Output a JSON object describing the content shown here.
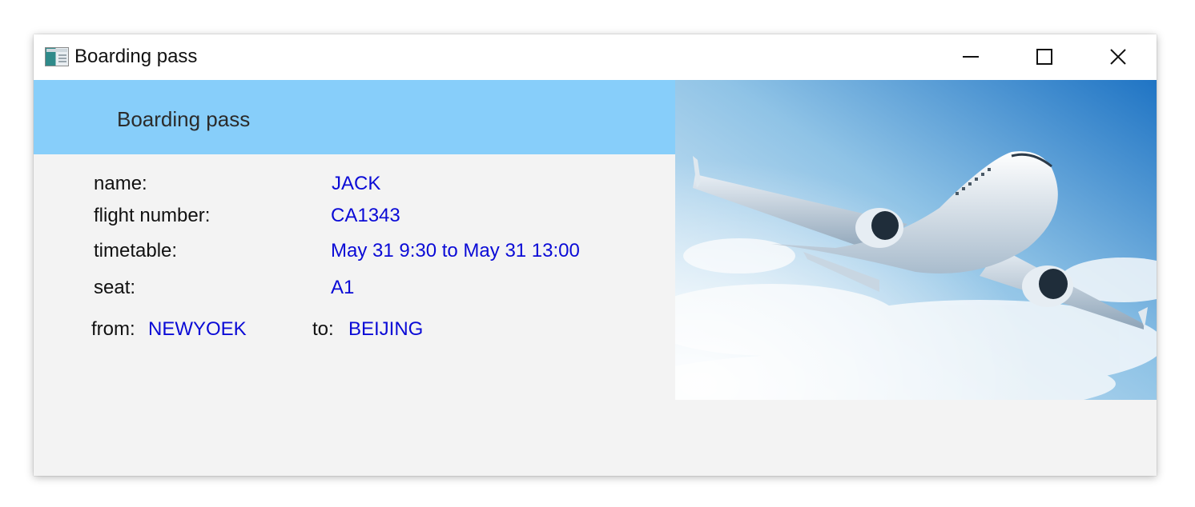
{
  "window": {
    "title": "Boarding pass",
    "icon": "application-icon",
    "controls": [
      "minimize-icon",
      "maximize-icon",
      "close-icon"
    ]
  },
  "banner": {
    "title": "Boarding pass",
    "color": "#87cefa"
  },
  "fields": {
    "name": {
      "label": "name:",
      "value": "JACK"
    },
    "flight_number": {
      "label": "flight number:",
      "value": "CA1343"
    },
    "timetable": {
      "label": "timetable:",
      "value": "May 31 9:30 to May 31 13:00"
    },
    "seat": {
      "label": "seat:",
      "value": "A1"
    },
    "from": {
      "label": "from:",
      "value": "NEWYOEK"
    },
    "to": {
      "label": "to:",
      "value": "BEIJING"
    }
  },
  "image": {
    "subject": "airplane-in-sky"
  },
  "colors": {
    "value_text": "#0a0ad6",
    "window_bg": "#f3f3f3"
  }
}
